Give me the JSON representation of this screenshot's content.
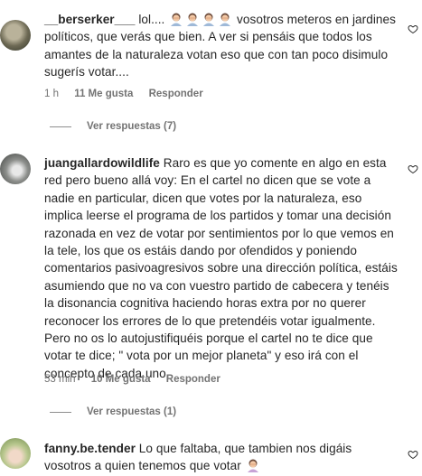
{
  "comments": [
    {
      "username": "__berserker___",
      "text_before_emoji": "lol....",
      "emoji_count": 4,
      "emoji_icon": "woman-facepalming-icon",
      "text_after_emoji": "vosotros meteros en jardines políticos, que verás que bien. A ver si pensáis que todos los amantes de la naturaleza votan eso que con tan poco disimulo sugerís votar....",
      "time": "1 h",
      "likes": "11 Me gusta",
      "reply_label": "Responder",
      "view_replies": "Ver respuestas (7)"
    },
    {
      "username": "juangallardowildlife",
      "text": "Raro es que yo comente en algo en esta red pero bueno allá voy: En el cartel no dicen que se vote a nadie en particular, dicen que votes por la naturaleza, eso implica leerse el programa de los partidos y tomar una decisión razonada en vez de votar por sentimientos por lo que vemos en la tele, los que os estáis dando por ofendidos y poniendo comentarios pasivoagresivos sobre una dirección política, estáis asumiendo que no va con vuestro partido de cabecera y tenéis la disonancia cognitiva haciendo horas extra por no querer reconocer los errores de lo que pretendéis votar igualmente. Pero no os lo autojustifiquéis porque el cartel no te dice que votar te dice; \" vota por un mejor planeta\" y eso irá con el concepto de cada uno.",
      "time": "53 min",
      "likes": "10 Me gusta",
      "reply_label": "Responder",
      "view_replies": "Ver respuestas (1)"
    },
    {
      "username": "fanny.be.tender",
      "text": "Lo que faltaba, que tambien nos digáis vosotros a quien tenemos que votar",
      "emoji_icon": "woman-facepalming-icon"
    }
  ]
}
